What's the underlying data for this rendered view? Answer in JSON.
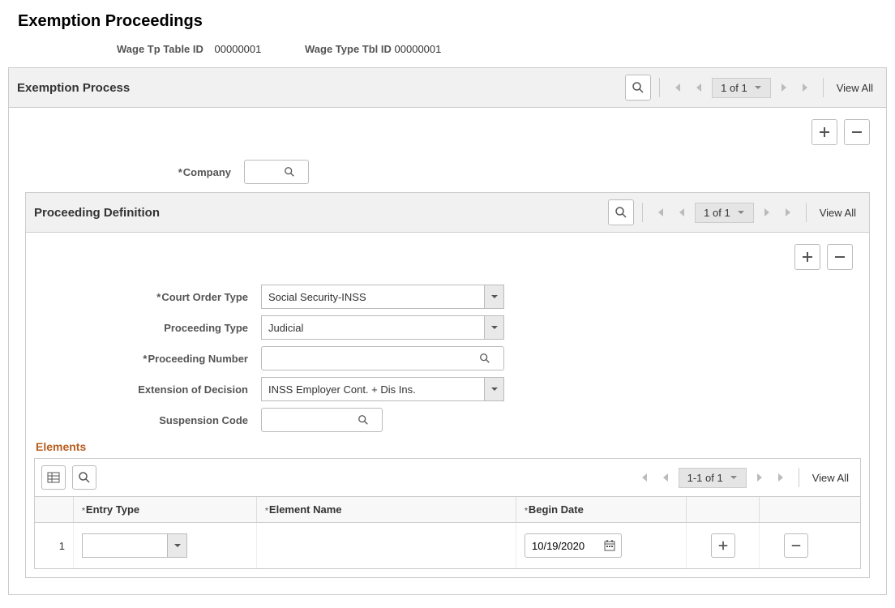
{
  "page": {
    "title": "Exemption Proceedings"
  },
  "header": {
    "wage_tp_label": "Wage Tp Table ID",
    "wage_tp_value": "00000001",
    "wage_type_label": "Wage Type Tbl ID",
    "wage_type_value": "00000001"
  },
  "exemption_section": {
    "title": "Exemption Process",
    "nav": {
      "indicator": "1 of 1",
      "view_all": "View All"
    },
    "company_label": "Company",
    "company_value": ""
  },
  "proceeding_section": {
    "title": "Proceeding Definition",
    "nav": {
      "indicator": "1 of 1",
      "view_all": "View All"
    },
    "fields": {
      "court_order_label": "Court Order Type",
      "court_order_value": "Social Security-INSS",
      "proceeding_type_label": "Proceeding Type",
      "proceeding_type_value": "Judicial",
      "proceeding_number_label": "Proceeding Number",
      "proceeding_number_value": "",
      "extension_label": "Extension of Decision",
      "extension_value": "INSS Employer Cont. + Dis Ins.",
      "suspension_label": "Suspension Code",
      "suspension_value": ""
    }
  },
  "elements_grid": {
    "title": "Elements",
    "nav": {
      "indicator": "1-1 of 1",
      "view_all": "View All"
    },
    "columns": {
      "entry_type": "Entry Type",
      "element_name": "Element Name",
      "begin_date": "Begin Date"
    },
    "rows": [
      {
        "num": "1",
        "entry_type": "",
        "element_name": "",
        "begin_date": "10/19/2020"
      }
    ]
  }
}
